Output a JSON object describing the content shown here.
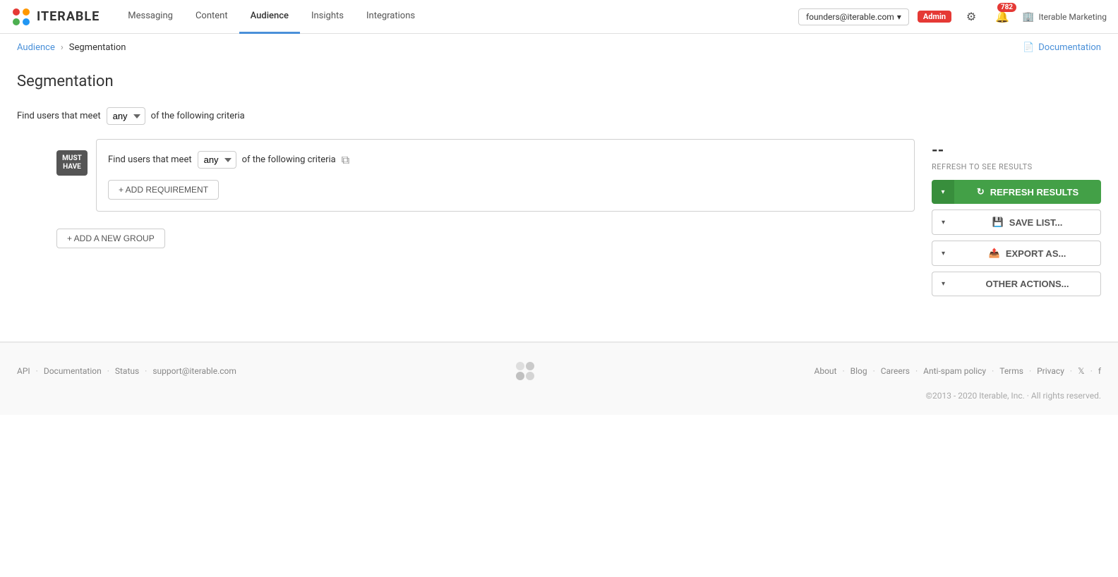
{
  "app": {
    "logo_text": "ITERABLE"
  },
  "nav": {
    "links": [
      {
        "id": "messaging",
        "label": "Messaging",
        "active": false
      },
      {
        "id": "content",
        "label": "Content",
        "active": false
      },
      {
        "id": "audience",
        "label": "Audience",
        "active": true
      },
      {
        "id": "insights",
        "label": "Insights",
        "active": false
      },
      {
        "id": "integrations",
        "label": "Integrations",
        "active": false
      }
    ],
    "account": "founders@iterable.com",
    "admin_label": "Admin",
    "notif_count": "782",
    "org_name": "Iterable Marketing"
  },
  "breadcrumb": {
    "parent": "Audience",
    "current": "Segmentation",
    "doc_label": "Documentation"
  },
  "page": {
    "title": "Segmentation",
    "criteria_prefix": "Find users that meet",
    "criteria_suffix": "of the following criteria",
    "top_select_value": "any"
  },
  "group": {
    "badge_line1": "MUST",
    "badge_line2": "HAVE",
    "criteria_prefix": "Find users that meet",
    "criteria_suffix": "of the following criteria",
    "select_value": "any",
    "add_req_label": "+ ADD REQUIREMENT",
    "copy_icon": "⧉"
  },
  "add_group_label": "+ ADD A NEW GROUP",
  "right_panel": {
    "count": "--",
    "refresh_hint": "REFRESH TO SEE RESULTS",
    "refresh_btn": "REFRESH RESULTS",
    "save_btn": "SAVE LIST...",
    "export_btn": "EXPORT AS...",
    "other_btn": "OTHER ACTIONS..."
  },
  "footer": {
    "links": [
      {
        "label": "API"
      },
      {
        "label": "Documentation"
      },
      {
        "label": "Status"
      },
      {
        "label": "support@iterable.com"
      }
    ],
    "right_links": [
      {
        "label": "About"
      },
      {
        "label": "Blog"
      },
      {
        "label": "Careers"
      },
      {
        "label": "Anti-spam policy"
      },
      {
        "label": "Terms"
      },
      {
        "label": "Privacy"
      }
    ],
    "copyright": "©2013 - 2020 Iterable, Inc. · All rights reserved."
  }
}
